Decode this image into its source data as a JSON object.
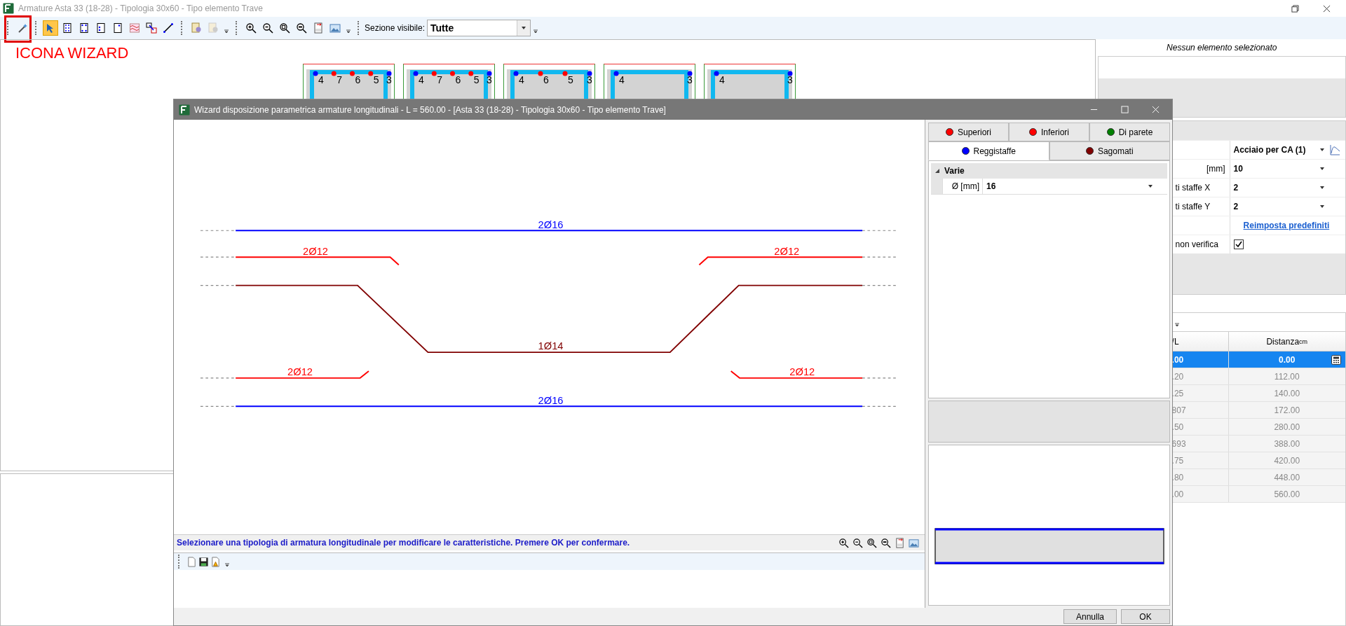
{
  "window": {
    "title": "Armature Asta 33 (18-28) - Tipologia 30x60 - Tipo elemento Trave"
  },
  "toolbar": {
    "tools": [
      {
        "selected": false
      },
      {
        "selected": true
      },
      {
        "selected": false
      },
      {
        "selected": false
      },
      {
        "selected": false
      },
      {
        "selected": false
      },
      {
        "selected": false
      },
      {
        "selected": false
      },
      {
        "selected": false
      },
      {
        "selected": false
      },
      {
        "selected": false
      },
      {
        "selected": false
      },
      {
        "selected": false
      },
      {
        "selected": false
      },
      {
        "selected": false
      },
      {
        "selected": false
      },
      {
        "selected": false
      }
    ],
    "section_label": "Sezione visibile:",
    "section_value": "Tutte"
  },
  "annotation": {
    "text": "ICONA WIZARD"
  },
  "sections": [
    {
      "marks": [
        {
          "label": "4",
          "color": "#0000ff"
        },
        {
          "label": "7",
          "color": "#ff0000"
        },
        {
          "label": "6",
          "color": "#ff0000"
        },
        {
          "label": "5",
          "color": "#ff0000"
        },
        {
          "label": "3",
          "color": "#0000ff"
        }
      ]
    },
    {
      "marks": [
        {
          "label": "4",
          "color": "#0000ff"
        },
        {
          "label": "7",
          "color": "#ff0000"
        },
        {
          "label": "6",
          "color": "#ff0000"
        },
        {
          "label": "5",
          "color": "#ff0000"
        },
        {
          "label": "3",
          "color": "#0000ff"
        }
      ]
    },
    {
      "marks": [
        {
          "label": "4",
          "color": "#0000ff"
        },
        {
          "label": "6",
          "color": "#ff0000"
        },
        {
          "label": "5",
          "color": "#ff0000"
        },
        {
          "label": "3",
          "color": "#0000ff"
        }
      ]
    },
    {
      "marks": [
        {
          "label": "4",
          "color": "#0000ff"
        },
        {
          "label": "3",
          "color": "#0000ff"
        }
      ]
    },
    {
      "marks": [
        {
          "label": "4",
          "color": "#0000ff"
        },
        {
          "label": "3",
          "color": "#0000ff"
        }
      ]
    }
  ],
  "side_panel": {
    "selection_text": "Nessun elemento selezionato",
    "properties": [
      {
        "kind": "dropdown",
        "value": "Acciaio per CA (1)"
      },
      {
        "kind": "dropdown",
        "label": "[mm]",
        "value": "10"
      },
      {
        "kind": "dropdown",
        "label": "ti staffe X",
        "value": "2"
      },
      {
        "kind": "dropdown",
        "label": "ti staffe Y",
        "value": "2"
      },
      {
        "kind": "link",
        "value": "Reimposta predefiniti"
      },
      {
        "kind": "checkbox",
        "label": "non verifica",
        "checked": true
      }
    ],
    "table": {
      "columns": [
        {
          "label": "/L"
        },
        {
          "label": "Distanza",
          "unit": "cm"
        }
      ],
      "rows": [
        {
          "cells": [
            ".00",
            "0.00"
          ],
          "selected": true
        },
        {
          "cells": [
            ".20",
            "112.00"
          ],
          "selected": false
        },
        {
          "cells": [
            ".25",
            "140.00"
          ],
          "selected": false
        },
        {
          "cells": [
            "807",
            "172.00"
          ],
          "selected": false
        },
        {
          "cells": [
            ".50",
            "280.00"
          ],
          "selected": false
        },
        {
          "cells": [
            "693",
            "388.00"
          ],
          "selected": false
        },
        {
          "cells": [
            ".75",
            "420.00"
          ],
          "selected": false
        },
        {
          "cells": [
            ".80",
            "448.00"
          ],
          "selected": false
        },
        {
          "cells": [
            ".00",
            "560.00"
          ],
          "selected": false
        }
      ]
    }
  },
  "wizard": {
    "title": "Wizard disposizione parametrica armature longitudinali - L = 560.00 - [Asta 33 (18-28) - Tipologia 30x60 - Tipo elemento Trave]",
    "bars": [
      {
        "kind": "straight",
        "label": "2Ø16",
        "color": "#0000ff"
      },
      {
        "kind": "hook_down_end",
        "label": "2Ø12",
        "color": "#ff0000"
      },
      {
        "kind": "hook_down_start",
        "label": "2Ø12",
        "color": "#ff0000"
      },
      {
        "kind": "bent",
        "label": "1Ø14",
        "color": "#800000"
      },
      {
        "kind": "hook_up_end",
        "label": "2Ø12",
        "color": "#ff0000"
      },
      {
        "kind": "hook_up_start",
        "label": "2Ø12",
        "color": "#ff0000"
      },
      {
        "kind": "straight",
        "label": "2Ø16",
        "color": "#0000ff"
      }
    ],
    "status_text": "Selezionare una tipologia di armatura longitudinale per modificare le caratteristiche. Premere OK per confermare.",
    "tabs": [
      {
        "label": "Superiori",
        "color": "#ff0000",
        "selected": false
      },
      {
        "label": "Inferiori",
        "color": "#ff0000",
        "selected": false
      },
      {
        "label": "Di parete",
        "color": "#008000",
        "selected": false
      },
      {
        "label": "Reggistaffe",
        "color": "#0000ff",
        "selected": true
      },
      {
        "label": "Sagomati",
        "color": "#800000",
        "selected": false
      }
    ],
    "group": {
      "label": "Varie",
      "expanded": true
    },
    "fields": [
      {
        "label": "Ø [mm]",
        "value": "16"
      }
    ],
    "buttons": [
      {
        "label": "Annulla"
      },
      {
        "label": "OK"
      }
    ]
  }
}
